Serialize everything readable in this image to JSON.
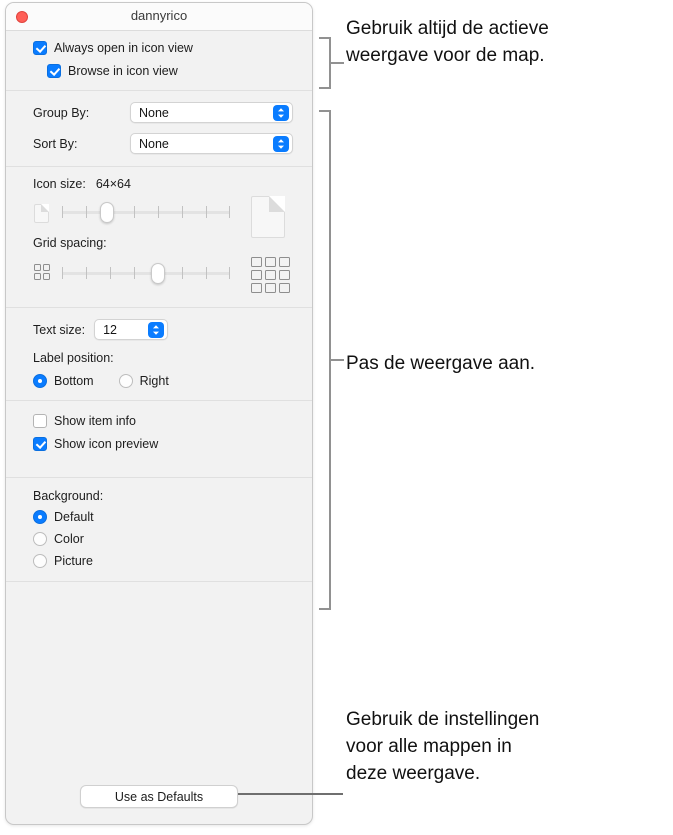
{
  "window": {
    "title": "dannyrico",
    "close_button": "close-button"
  },
  "view_options": {
    "checkboxes_top": [
      {
        "label": "Always open in icon view",
        "checked": true,
        "indent": false
      },
      {
        "label": "Browse in icon view",
        "checked": true,
        "indent": true
      }
    ],
    "group_by": {
      "label": "Group By:",
      "value": "None"
    },
    "sort_by": {
      "label": "Sort By:",
      "value": "None"
    },
    "icon_size": {
      "label": "Icon size:",
      "value": "64×64",
      "ticks": 8,
      "thumb_percent": 18
    },
    "grid_spacing": {
      "label": "Grid spacing:",
      "ticks": 8,
      "thumb_percent": 47
    },
    "text_size": {
      "label": "Text size:",
      "value": "12"
    },
    "label_position": {
      "label": "Label position:",
      "options": [
        {
          "label": "Bottom",
          "selected": true
        },
        {
          "label": "Right",
          "selected": false
        }
      ]
    },
    "checkboxes_mid": [
      {
        "label": "Show item info",
        "checked": false
      },
      {
        "label": "Show icon preview",
        "checked": true
      }
    ],
    "background": {
      "label": "Background:",
      "options": [
        {
          "label": "Default",
          "selected": true
        },
        {
          "label": "Color",
          "selected": false
        },
        {
          "label": "Picture",
          "selected": false
        }
      ]
    },
    "use_as_defaults_button": "Use as Defaults"
  },
  "annotations": [
    {
      "text": "Gebruik altijd de actieve\nweergave voor de map."
    },
    {
      "text": "Pas de weergave aan."
    },
    {
      "text": "Gebruik de instellingen\nvoor alle mappen in\ndeze weergave."
    }
  ],
  "colors": {
    "accent": "#0a7cff",
    "close": "#ff5f57",
    "window_bg": "#f2f2f2",
    "titlebar_bg": "#fbfbfb",
    "divider": "#e0e0e0",
    "callout": "#919191"
  }
}
